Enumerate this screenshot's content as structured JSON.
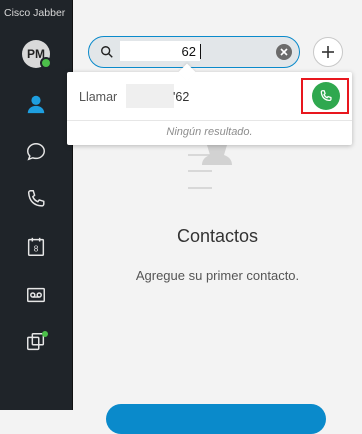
{
  "app": {
    "title": "Cisco Jabber"
  },
  "user": {
    "initials": "PM",
    "presence": "available"
  },
  "sidebar": {
    "items": [
      {
        "name": "contacts",
        "icon": "person-icon",
        "active": true
      },
      {
        "name": "chats",
        "icon": "chat-bubble-icon"
      },
      {
        "name": "calls",
        "icon": "phone-icon"
      },
      {
        "name": "meetings",
        "icon": "calendar-icon",
        "calendar_day": "8"
      },
      {
        "name": "voicemail",
        "icon": "voicemail-icon"
      },
      {
        "name": "custom-tabs",
        "icon": "window-icon",
        "has_notification": true
      }
    ]
  },
  "search": {
    "value": "62"
  },
  "dropdown": {
    "call_label": "Llamar",
    "call_number_visible": "'62",
    "no_results": "Ningún resultado."
  },
  "empty_state": {
    "title": "Contactos",
    "subtitle": "Agregue su primer contacto."
  },
  "colors": {
    "rail_bg": "#1f2429",
    "accent": "#0a8acb",
    "call_green": "#2fa84f",
    "highlight_red": "#e8171e",
    "presence_green": "#4cc04a"
  }
}
